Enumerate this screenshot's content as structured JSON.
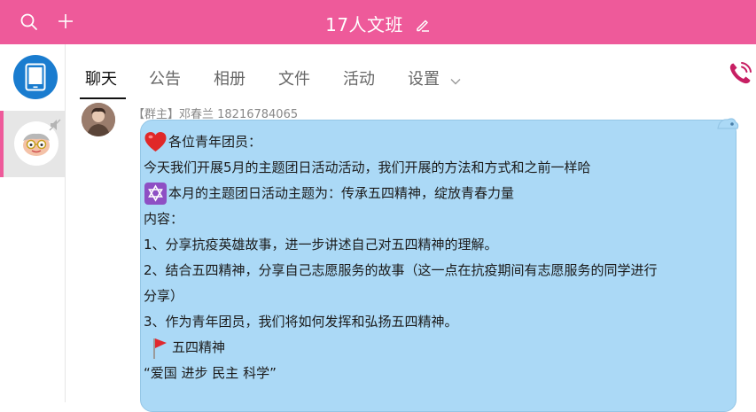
{
  "titlebar": {
    "title": "17人文班",
    "icons": [
      "search-icon",
      "plus-icon",
      "edit-icon"
    ],
    "color": "#ee5a9a"
  },
  "leftbar": {
    "items": [
      {
        "name": "my-device",
        "icon": "phone-device-icon",
        "color": "#1a7ccf"
      },
      {
        "name": "group-chat",
        "icon": "group-avatar",
        "selected": true
      }
    ]
  },
  "tabs": [
    {
      "label": "聊天",
      "active": true
    },
    {
      "label": "公告"
    },
    {
      "label": "相册"
    },
    {
      "label": "文件"
    },
    {
      "label": "活动"
    },
    {
      "label": "设置",
      "has_dropdown": true
    }
  ],
  "call_icon": "phone-call-icon",
  "message": {
    "sender": "【群主】邓春兰 18216784065",
    "lines": [
      {
        "emoji": "heart-icon",
        "text": "各位青年团员："
      },
      {
        "text": "今天我们开展5月的主题团日活动活动，我们开展的方法和方式和之前一样哈"
      },
      {
        "emoji": "star-of-david-icon",
        "text": "本月的主题团日活动主题为：传承五四精神，绽放青春力量"
      },
      {
        "text": "内容："
      },
      {
        "text": "1、分享抗疫英雄故事，进一步讲述自己对五四精神的理解。"
      },
      {
        "text": "2、结合五四精神，分享自己志愿服务的故事（这一点在抗疫期间有志愿服务的同学进行"
      },
      {
        "text": "分享）"
      },
      {
        "text": "3、作为青年团员，我们将如何发挥和弘扬五四精神。"
      },
      {
        "emoji": "red-flag-icon",
        "text": "五四精神"
      },
      {
        "text": " “爱国 进步 民主 科学”"
      }
    ],
    "bubble_color": "#abd9f6"
  }
}
